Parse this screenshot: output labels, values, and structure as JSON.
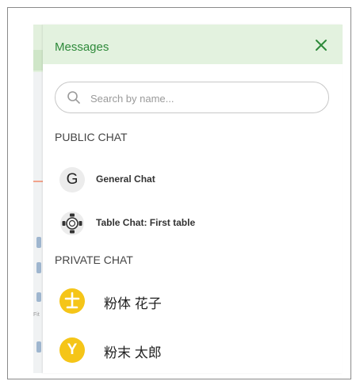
{
  "header": {
    "title": "Messages"
  },
  "search": {
    "placeholder": "Search by name..."
  },
  "sections": {
    "public": "PUBLIC CHAT",
    "private": "PRIVATE CHAT"
  },
  "public_chats": [
    {
      "avatar_letter": "G",
      "label": "General Chat"
    },
    {
      "avatar_icon": "table-chat-icon",
      "label": "Table Chat: First table"
    }
  ],
  "private_chats": [
    {
      "avatar_icon": "yellow-avatar-symbol",
      "label": "粉体 花子"
    },
    {
      "avatar_letter": "Y",
      "label": "粉末 太郎"
    }
  ],
  "colors": {
    "header_bg": "#e3f2df",
    "accent_green": "#2e8a3a",
    "avatar_yellow": "#f5c518"
  }
}
